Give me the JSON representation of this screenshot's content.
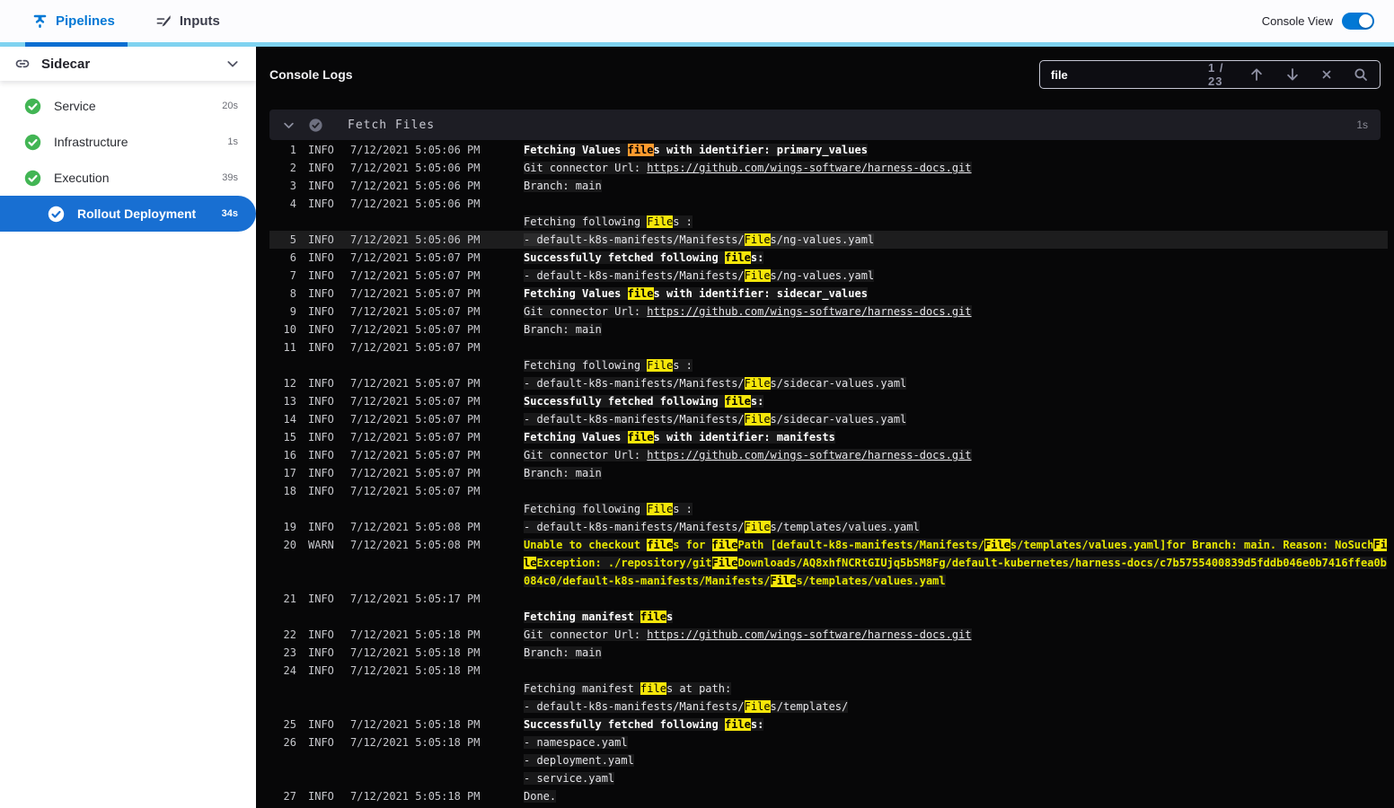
{
  "colors": {
    "accent": "#0278d5",
    "divider_strip": "#7fd3f1",
    "active_tab_underline": "#0b6fd2",
    "selected_step_blue": "#186fd2",
    "success_green": "#42b554",
    "search_highlight_yellow": "#f6e60a",
    "search_current_orange": "#ff9a2e",
    "warn_text_yellow": "#e8e800"
  },
  "topbar": {
    "tabs": [
      {
        "label": "Pipelines",
        "active": true
      },
      {
        "label": "Inputs",
        "active": false
      }
    ],
    "console_view_label": "Console View",
    "console_view_on": true
  },
  "sidebar": {
    "title": "Sidecar",
    "items": [
      {
        "label": "Service",
        "duration": "20s",
        "status": "success"
      },
      {
        "label": "Infrastructure",
        "duration": "1s",
        "status": "success"
      },
      {
        "label": "Execution",
        "duration": "39s",
        "status": "success"
      },
      {
        "label": "Rollout Deployment",
        "duration": "34s",
        "status": "success",
        "selected": true,
        "indent": true
      }
    ]
  },
  "console": {
    "title": "Console Logs",
    "search": {
      "query": "file",
      "match_position": "1 / 23"
    },
    "section": {
      "title": "Fetch Files",
      "duration": "1s"
    },
    "rows": [
      {
        "n": "1",
        "l": "INFO",
        "t": "7/12/2021 5:05:06 PM",
        "b": 1,
        "s": [
          [
            "Fetching Values ",
            ""
          ],
          [
            "file",
            "cur"
          ],
          [
            "s with identifier: primary_values",
            ""
          ]
        ]
      },
      {
        "n": "2",
        "l": "INFO",
        "t": "7/12/2021 5:05:06 PM",
        "s": [
          [
            "Git connector Url: ",
            ""
          ],
          [
            "https://github.com/wings-software/harness-docs.git",
            "link"
          ]
        ]
      },
      {
        "n": "3",
        "l": "INFO",
        "t": "7/12/2021 5:05:06 PM",
        "s": [
          [
            "Branch: main",
            ""
          ]
        ]
      },
      {
        "n": "4",
        "l": "INFO",
        "t": "7/12/2021 5:05:06 PM",
        "s": []
      },
      {
        "s": [
          [
            "Fetching following ",
            ""
          ],
          [
            "File",
            "hl"
          ],
          [
            "s :",
            ""
          ]
        ]
      },
      {
        "n": "5",
        "l": "INFO",
        "t": "7/12/2021 5:05:06 PM",
        "sel": 1,
        "s": [
          [
            "- default-k8s-manifests/Manifests/",
            ""
          ],
          [
            "File",
            "hl"
          ],
          [
            "s/ng-values.yaml",
            ""
          ]
        ]
      },
      {
        "n": "6",
        "l": "INFO",
        "t": "7/12/2021 5:05:07 PM",
        "b": 1,
        "s": [
          [
            "Successfully fetched following ",
            ""
          ],
          [
            "file",
            "hl"
          ],
          [
            "s:",
            ""
          ]
        ]
      },
      {
        "n": "7",
        "l": "INFO",
        "t": "7/12/2021 5:05:07 PM",
        "s": [
          [
            "- default-k8s-manifests/Manifests/",
            ""
          ],
          [
            "File",
            "hl"
          ],
          [
            "s/ng-values.yaml",
            ""
          ]
        ]
      },
      {
        "n": "8",
        "l": "INFO",
        "t": "7/12/2021 5:05:07 PM",
        "b": 1,
        "s": [
          [
            "Fetching Values ",
            ""
          ],
          [
            "file",
            "hl"
          ],
          [
            "s with identifier: sidecar_values",
            ""
          ]
        ]
      },
      {
        "n": "9",
        "l": "INFO",
        "t": "7/12/2021 5:05:07 PM",
        "s": [
          [
            "Git connector Url: ",
            ""
          ],
          [
            "https://github.com/wings-software/harness-docs.git",
            "link"
          ]
        ]
      },
      {
        "n": "10",
        "l": "INFO",
        "t": "7/12/2021 5:05:07 PM",
        "s": [
          [
            "Branch: main",
            ""
          ]
        ]
      },
      {
        "n": "11",
        "l": "INFO",
        "t": "7/12/2021 5:05:07 PM",
        "s": []
      },
      {
        "s": [
          [
            "Fetching following ",
            ""
          ],
          [
            "File",
            "hl"
          ],
          [
            "s :",
            ""
          ]
        ]
      },
      {
        "n": "12",
        "l": "INFO",
        "t": "7/12/2021 5:05:07 PM",
        "s": [
          [
            "- default-k8s-manifests/Manifests/",
            ""
          ],
          [
            "File",
            "hl"
          ],
          [
            "s/sidecar-values.yaml",
            ""
          ]
        ]
      },
      {
        "n": "13",
        "l": "INFO",
        "t": "7/12/2021 5:05:07 PM",
        "b": 1,
        "s": [
          [
            "Successfully fetched following ",
            ""
          ],
          [
            "file",
            "hl"
          ],
          [
            "s:",
            ""
          ]
        ]
      },
      {
        "n": "14",
        "l": "INFO",
        "t": "7/12/2021 5:05:07 PM",
        "s": [
          [
            "- default-k8s-manifests/Manifests/",
            ""
          ],
          [
            "File",
            "hl"
          ],
          [
            "s/sidecar-values.yaml",
            ""
          ]
        ]
      },
      {
        "n": "15",
        "l": "INFO",
        "t": "7/12/2021 5:05:07 PM",
        "b": 1,
        "s": [
          [
            "Fetching Values ",
            ""
          ],
          [
            "file",
            "hl"
          ],
          [
            "s with identifier: manifests",
            ""
          ]
        ]
      },
      {
        "n": "16",
        "l": "INFO",
        "t": "7/12/2021 5:05:07 PM",
        "s": [
          [
            "Git connector Url: ",
            ""
          ],
          [
            "https://github.com/wings-software/harness-docs.git",
            "link"
          ]
        ]
      },
      {
        "n": "17",
        "l": "INFO",
        "t": "7/12/2021 5:05:07 PM",
        "s": [
          [
            "Branch: main",
            ""
          ]
        ]
      },
      {
        "n": "18",
        "l": "INFO",
        "t": "7/12/2021 5:05:07 PM",
        "s": []
      },
      {
        "s": [
          [
            "Fetching following ",
            ""
          ],
          [
            "File",
            "hl"
          ],
          [
            "s :",
            ""
          ]
        ]
      },
      {
        "n": "19",
        "l": "INFO",
        "t": "7/12/2021 5:05:08 PM",
        "s": [
          [
            "- default-k8s-manifests/Manifests/",
            ""
          ],
          [
            "File",
            "hl"
          ],
          [
            "s/templates/values.yaml",
            ""
          ]
        ]
      },
      {
        "n": "20",
        "l": "WARN",
        "t": "7/12/2021 5:05:08 PM",
        "b": 1,
        "w": 1,
        "s": [
          [
            "Unable to checkout ",
            ""
          ],
          [
            "file",
            "hl"
          ],
          [
            "s for ",
            ""
          ],
          [
            "file",
            "hl"
          ],
          [
            "Path [default-k8s-manifests/Manifests/",
            ""
          ],
          [
            "File",
            "hl"
          ],
          [
            "s/templates/values.yaml]for Branch: main. Reason: NoSuch",
            ""
          ],
          [
            "File",
            "hl"
          ],
          [
            "Exception: ./repository/git",
            ""
          ],
          [
            "File",
            "hl"
          ],
          [
            "Downloads/AQ8xhfNCRtGIUjq5bSM8Fg/default-kubernetes/harness-docs/c7b5755400839d5fddb046e0b7416ffea0b084c0/default-k8s-manifests/Manifests/",
            ""
          ],
          [
            "File",
            "hl"
          ],
          [
            "s/templates/values.yaml",
            ""
          ]
        ]
      },
      {
        "n": "21",
        "l": "INFO",
        "t": "7/12/2021 5:05:17 PM",
        "s": []
      },
      {
        "b": 1,
        "s": [
          [
            "Fetching manifest ",
            ""
          ],
          [
            "file",
            "hl"
          ],
          [
            "s",
            ""
          ]
        ]
      },
      {
        "n": "22",
        "l": "INFO",
        "t": "7/12/2021 5:05:18 PM",
        "s": [
          [
            "Git connector Url: ",
            ""
          ],
          [
            "https://github.com/wings-software/harness-docs.git",
            "link"
          ]
        ]
      },
      {
        "n": "23",
        "l": "INFO",
        "t": "7/12/2021 5:05:18 PM",
        "s": [
          [
            "Branch: main",
            ""
          ]
        ]
      },
      {
        "n": "24",
        "l": "INFO",
        "t": "7/12/2021 5:05:18 PM",
        "s": []
      },
      {
        "s": [
          [
            "Fetching manifest ",
            ""
          ],
          [
            "file",
            "hl"
          ],
          [
            "s at path:",
            ""
          ]
        ]
      },
      {
        "s": [
          [
            "- default-k8s-manifests/Manifests/",
            ""
          ],
          [
            "File",
            "hl"
          ],
          [
            "s/templates/",
            ""
          ]
        ]
      },
      {
        "n": "25",
        "l": "INFO",
        "t": "7/12/2021 5:05:18 PM",
        "b": 1,
        "s": [
          [
            "Successfully fetched following ",
            ""
          ],
          [
            "file",
            "hl"
          ],
          [
            "s:",
            ""
          ]
        ]
      },
      {
        "n": "26",
        "l": "INFO",
        "t": "7/12/2021 5:05:18 PM",
        "s": [
          [
            "- namespace.yaml",
            ""
          ]
        ]
      },
      {
        "s": [
          [
            "- deployment.yaml",
            ""
          ]
        ]
      },
      {
        "s": [
          [
            "- service.yaml",
            ""
          ]
        ]
      },
      {
        "n": "27",
        "l": "INFO",
        "t": "7/12/2021 5:05:18 PM",
        "s": [
          [
            "Done.",
            ""
          ]
        ]
      }
    ]
  }
}
